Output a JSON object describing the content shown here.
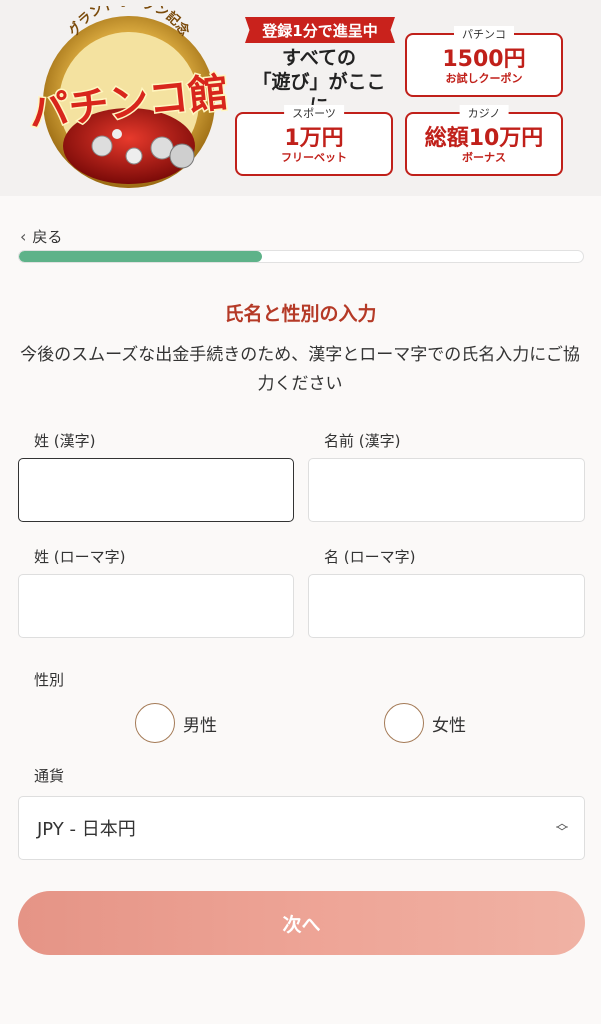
{
  "banner": {
    "logo_arc_text": "グランドオープン記念",
    "logo_text": "パチンコ館",
    "tag": "登録1分で進呈中",
    "tagline_line1": "すべての",
    "tagline_line2": "「遊び」がここに",
    "promos": [
      {
        "title": "パチンコ",
        "main": "1500円",
        "sub": "お試しクーポン"
      },
      {
        "title": "スポーツ",
        "main": "1万円",
        "sub": "フリーベット"
      },
      {
        "title": "カジノ",
        "main": "総額10万円",
        "sub": "ボーナス"
      }
    ]
  },
  "nav": {
    "back_label": "戻る",
    "progress": 0.43
  },
  "form": {
    "title": "氏名と性別の入力",
    "description": "今後のスムーズな出金手続きのため、漢字とローマ字での氏名入力にご協力ください",
    "last_name_kanji_label": "姓 (漢字)",
    "first_name_kanji_label": "名前 (漢字)",
    "last_name_roman_label": "姓 (ローマ字)",
    "first_name_roman_label": "名 (ローマ字)",
    "last_name_kanji_value": "",
    "first_name_kanji_value": "",
    "last_name_roman_value": "",
    "first_name_roman_value": "",
    "gender_label": "性別",
    "gender_options": [
      "男性",
      "女性"
    ],
    "currency_label": "通貨",
    "currency_value": "JPY - 日本円",
    "next_label": "次へ"
  },
  "colors": {
    "accent": "#b53a27",
    "progress": "#5eb289",
    "button": "#eea597",
    "promo_red": "#c0201a"
  }
}
